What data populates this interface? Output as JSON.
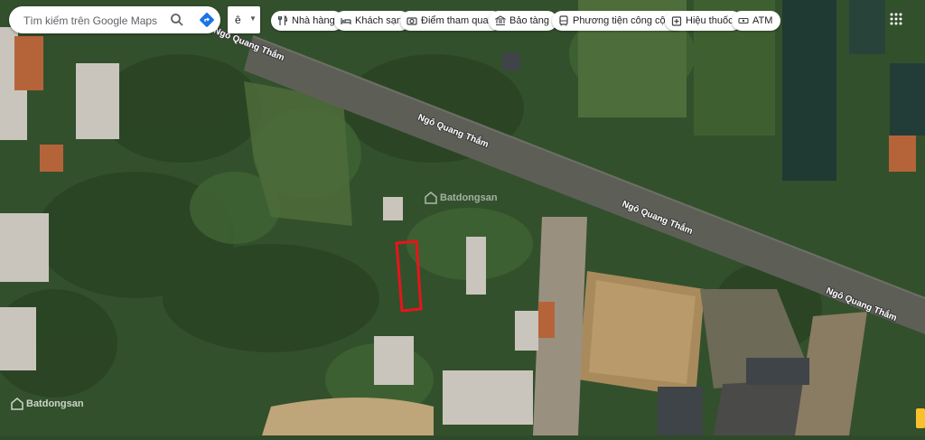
{
  "search": {
    "placeholder": "Tìm kiếm trên Google Maps"
  },
  "language_button": {
    "label": "ê"
  },
  "categories": [
    {
      "label": "Nhà hàng",
      "icon": "restaurant-icon"
    },
    {
      "label": "Khách sạn",
      "icon": "hotel-icon"
    },
    {
      "label": "Điểm tham quan",
      "icon": "camera-icon"
    },
    {
      "label": "Bảo tàng",
      "icon": "museum-icon"
    },
    {
      "label": "Phương tiện công cộng",
      "icon": "transit-icon"
    },
    {
      "label": "Hiệu thuốc",
      "icon": "pharmacy-icon"
    },
    {
      "label": "ATM",
      "icon": "atm-icon"
    }
  ],
  "map": {
    "view": "satellite",
    "road_labels": [
      "Ngô Quang Thắm",
      "Ngô Quang Thắm",
      "Ngô Quang Thắm",
      "Ngô Quang Thắm"
    ],
    "highlight_color": "#e8141b"
  },
  "watermark": {
    "text": "Batdongsan"
  }
}
